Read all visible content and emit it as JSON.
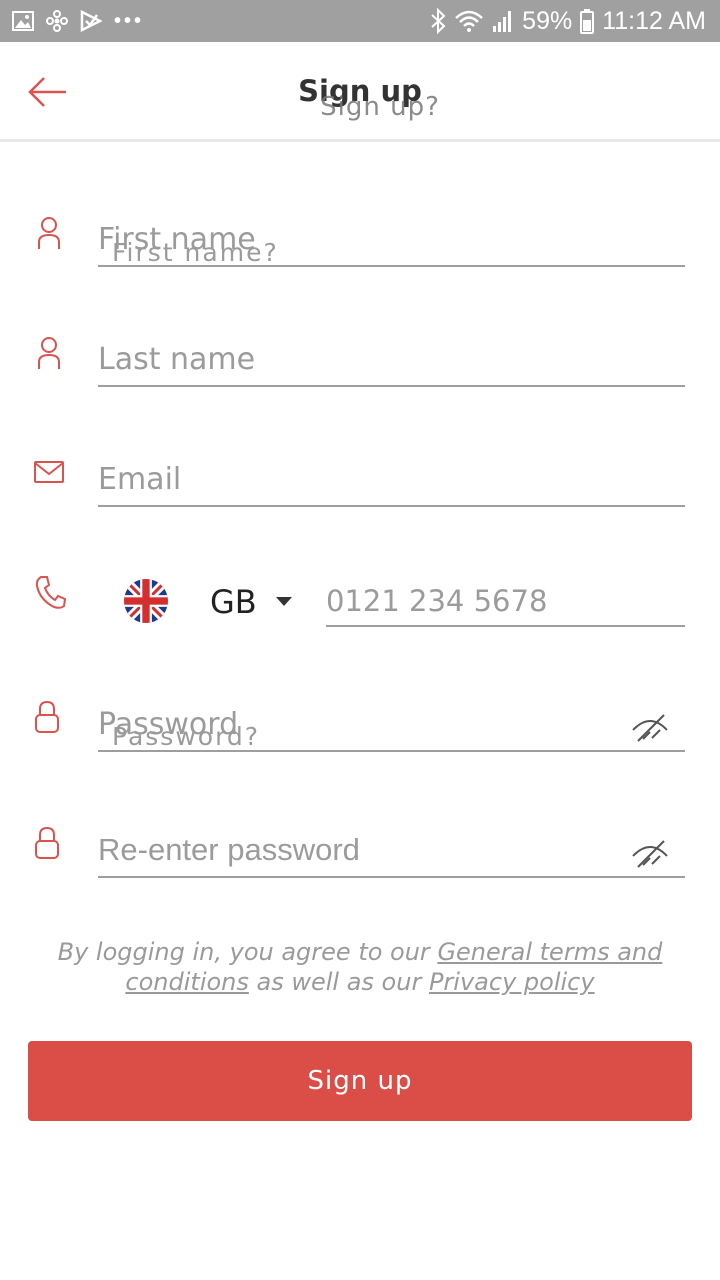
{
  "status_bar": {
    "battery": "59%",
    "time": "11:12 AM",
    "dots": "•••"
  },
  "header": {
    "title": "Sign up",
    "title_ghost": "Sign up?"
  },
  "form": {
    "first_name": {
      "placeholder": "First name",
      "ghost": "First name?"
    },
    "last_name": {
      "placeholder": "Last name"
    },
    "email": {
      "placeholder": "Email"
    },
    "phone": {
      "country": "GB",
      "placeholder": "0121 234 5678"
    },
    "password": {
      "placeholder": "Password",
      "ghost": "Password?"
    },
    "reenter_password": {
      "placeholder": "Re-enter password"
    }
  },
  "terms": {
    "prefix": "By logging in, you agree to our ",
    "terms_link": "General terms and conditions",
    "middle": " as well as our ",
    "privacy_link": "Privacy policy"
  },
  "button": {
    "label": "Sign up"
  },
  "colors": {
    "accent": "#db4e47",
    "statusbar": "#a0a0a0",
    "icon": "#d9534f"
  },
  "icons": [
    "image-icon",
    "fan-icon",
    "flag-app-icon",
    "bluetooth-icon",
    "wifi-icon",
    "signal-icon",
    "battery-icon",
    "back-arrow-icon",
    "person-icon",
    "mail-icon",
    "phone-icon",
    "lock-icon",
    "eye-off-icon",
    "uk-flag-icon",
    "caret-down-icon"
  ]
}
